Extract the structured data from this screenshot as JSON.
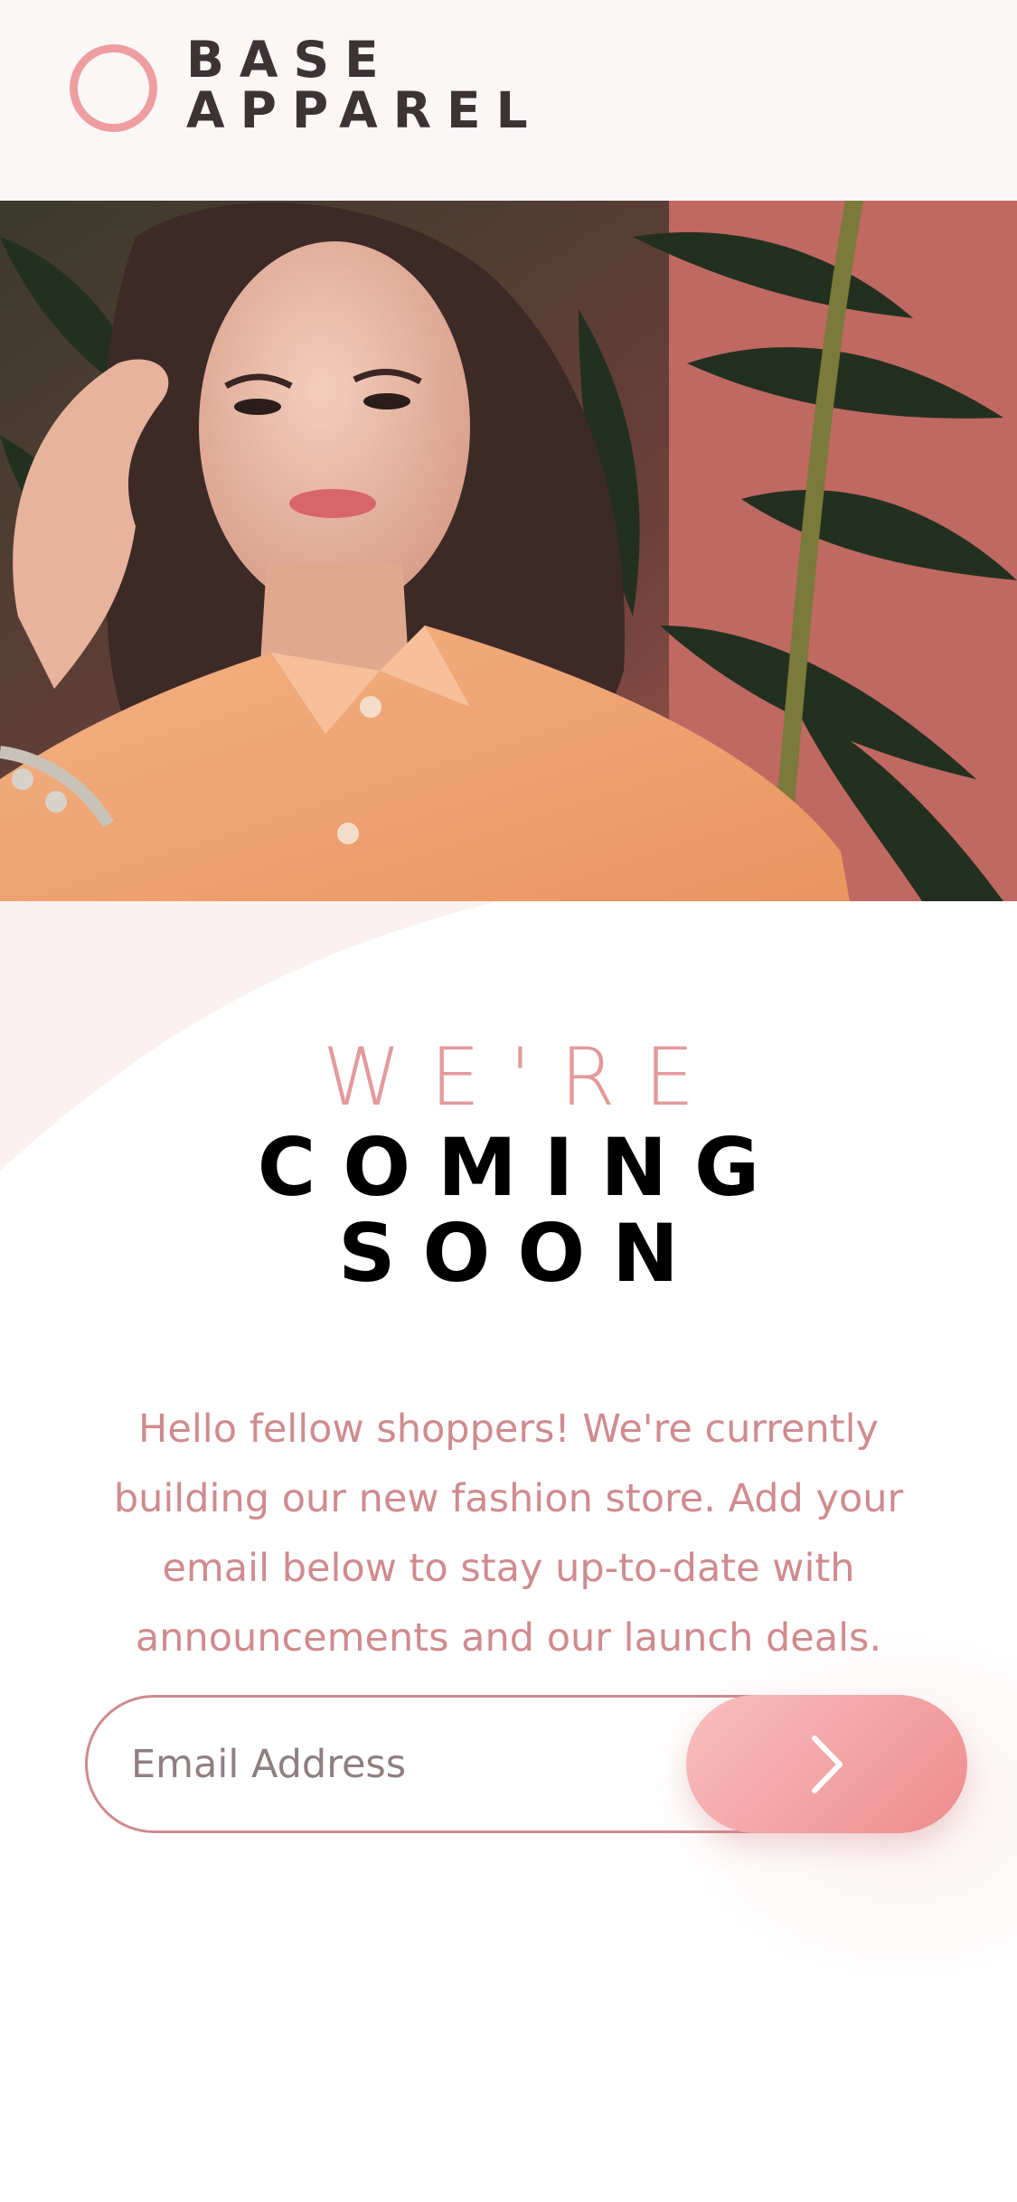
{
  "brand": {
    "line1": "BASE",
    "line2": "APPAREL",
    "logo_icon": "ring-logo-icon",
    "logo_color": "#ee9ea1"
  },
  "hero": {
    "image": "woman-in-orange-shirt-photo"
  },
  "headline": {
    "light": "WE'RE",
    "strong_line1": "COMING",
    "strong_line2": "SOON"
  },
  "description": "Hello fellow shoppers! We're currently building our new fashion store. Add your email below to stay up-to-date with announcements and our launch deals.",
  "form": {
    "email_placeholder": "Email Address",
    "submit_icon": "chevron-right-icon"
  },
  "colors": {
    "accent": "#cf8b8f",
    "button_gradient_start": "#f8bfbf",
    "button_gradient_end": "#ee8c8d",
    "text_dark": "#3b3334",
    "headline_light": "#e39a9c"
  }
}
